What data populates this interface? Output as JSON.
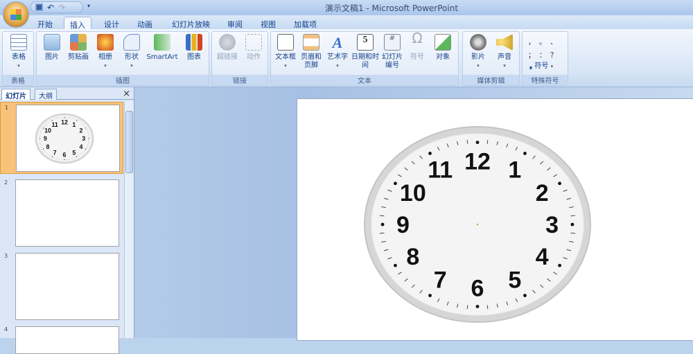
{
  "window": {
    "title": "演示文稿1 - Microsoft PowerPoint"
  },
  "qat": {
    "save": "save-icon",
    "undo": "↶",
    "redo": "↷",
    "more": "▾"
  },
  "tabs": [
    "开始",
    "插入",
    "设计",
    "动画",
    "幻灯片放映",
    "审阅",
    "视图",
    "加载项"
  ],
  "active_tab": "插入",
  "ribbon": {
    "groups": [
      {
        "label": "表格",
        "buttons": [
          "表格"
        ]
      },
      {
        "label": "插图",
        "buttons": [
          "图片",
          "剪贴画",
          "相册",
          "形状",
          "SmartArt",
          "图表"
        ]
      },
      {
        "label": "链接",
        "buttons": [
          "超链接",
          "动作"
        ]
      },
      {
        "label": "文本",
        "buttons": [
          "文本框",
          "页眉和页脚",
          "艺术字",
          "日期和时间",
          "幻灯片编号",
          "符号",
          "对象"
        ]
      },
      {
        "label": "媒体剪辑",
        "buttons": [
          "影片",
          "声音"
        ]
      },
      {
        "label": "特殊符号",
        "symbols": [
          "，",
          "。",
          "、",
          "；",
          "：",
          "？"
        ],
        "button": "符号"
      }
    ]
  },
  "pane": {
    "tabs": [
      "幻灯片",
      "大纲"
    ],
    "close": "×",
    "slides": [
      "1",
      "2",
      "3",
      "4"
    ],
    "selected": 1
  },
  "slide": {
    "clock_numbers": [
      "12",
      "1",
      "2",
      "3",
      "4",
      "5",
      "6",
      "7",
      "8",
      "9",
      "10",
      "11"
    ]
  },
  "colors": {
    "accent": "#f8c27a",
    "ribbon": "#dbe7f6"
  }
}
